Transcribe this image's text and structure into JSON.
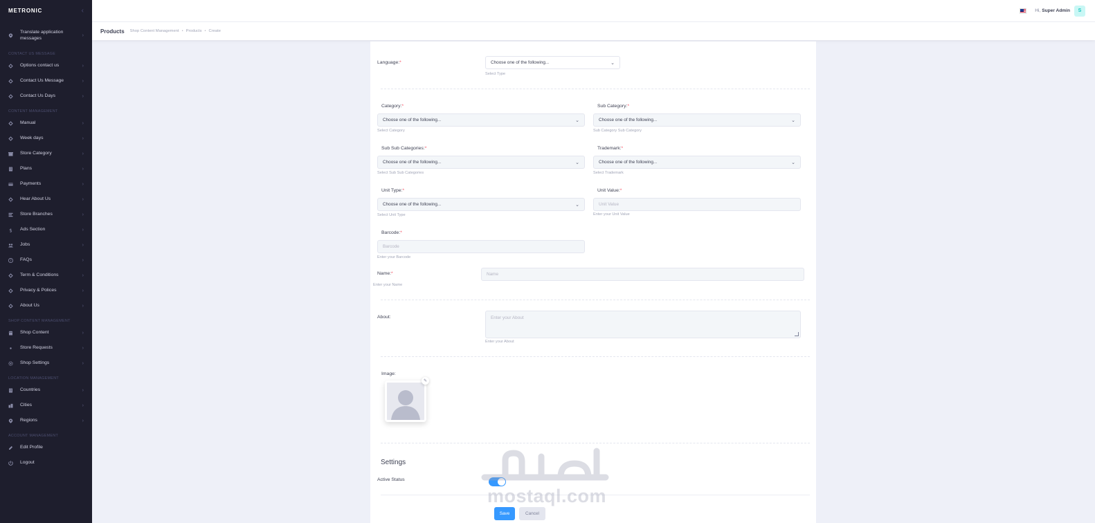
{
  "brand": {
    "name": "METRONIC"
  },
  "sidebar": {
    "top_item": {
      "label": "Translate application messages",
      "icon": "pin-icon"
    },
    "sections": [
      {
        "title": "CONTACT US MESSAGE",
        "items": [
          {
            "label": "Options contact us",
            "icon": "diamond-icon"
          },
          {
            "label": "Contact Us Message",
            "icon": "diamond-icon"
          },
          {
            "label": "Contact Us Days",
            "icon": "diamond-icon"
          }
        ]
      },
      {
        "title": "CONTENT MANAGEMENT",
        "items": [
          {
            "label": "Manual",
            "icon": "diamond-icon"
          },
          {
            "label": "Week days",
            "icon": "diamond-icon"
          },
          {
            "label": "Store Category",
            "icon": "store-icon"
          },
          {
            "label": "Plans",
            "icon": "building-icon"
          },
          {
            "label": "Payments",
            "icon": "card-icon"
          },
          {
            "label": "Hear About Us",
            "icon": "diamond-icon"
          },
          {
            "label": "Store Branches",
            "icon": "branches-icon"
          },
          {
            "label": "Ads Section",
            "icon": "dollar-icon"
          },
          {
            "label": "Jobs",
            "icon": "jobs-icon"
          },
          {
            "label": "FAQs",
            "icon": "question-icon"
          },
          {
            "label": "Term & Conditions",
            "icon": "diamond-icon"
          },
          {
            "label": "Privacy & Polices",
            "icon": "diamond-icon"
          },
          {
            "label": "About Us",
            "icon": "diamond-icon"
          }
        ]
      },
      {
        "title": "SHOP CONTENT MANAGEMENT",
        "items": [
          {
            "label": "Shop Content",
            "icon": "shop-icon"
          },
          {
            "label": "Store Requests",
            "icon": "dot-icon"
          },
          {
            "label": "Shop Settings",
            "icon": "settings-icon"
          }
        ]
      },
      {
        "title": "LOCATION MANAGEMENT",
        "items": [
          {
            "label": "Countries",
            "icon": "building-icon"
          },
          {
            "label": "Cities",
            "icon": "city-icon"
          },
          {
            "label": "Regions",
            "icon": "pin-icon"
          }
        ]
      },
      {
        "title": "ACCOUNT MANAGEMENT",
        "items": [
          {
            "label": "Edit Profile",
            "icon": "edit-icon",
            "arrow": false
          },
          {
            "label": "Logout",
            "icon": "logout-icon",
            "arrow": false
          }
        ]
      }
    ]
  },
  "header": {
    "greeting": "Hi,",
    "user_name": "Super Admin",
    "avatar_letter": "S"
  },
  "subheader": {
    "title": "Products",
    "breadcrumbs": [
      "Shop Content Management",
      "Products",
      "Create"
    ]
  },
  "form": {
    "language": {
      "label": "Language:",
      "value": "Choose one of the following...",
      "hint": "Select Type"
    },
    "category": {
      "label": "Category:",
      "value": "Choose one of the following...",
      "hint": "Select Category"
    },
    "sub_category": {
      "label": "Sub Category:",
      "value": "Choose one of the following...",
      "hint": "Sub Category Sub Category"
    },
    "sub_sub_categories": {
      "label": "Sub Sub Categories:",
      "value": "Choose one of the following...",
      "hint": "Select Sub Sub Categories"
    },
    "trademark": {
      "label": "Trademark:",
      "value": "Choose one of the following...",
      "hint": "Select Trademark"
    },
    "unit_type": {
      "label": "Unit Type:",
      "value": "Choose one of the following...",
      "hint": "Select Unit Type"
    },
    "unit_value": {
      "label": "Unit Value:",
      "placeholder": "Unit Value",
      "hint": "Enter your Unit Value"
    },
    "barcode": {
      "label": "Barcode:",
      "placeholder": "Barcode",
      "hint": "Enter your Barcode"
    },
    "name": {
      "label": "Name:",
      "placeholder": "Name",
      "hint": "Enter your Name"
    },
    "about": {
      "label": "About:",
      "placeholder": "Enter your  About",
      "hint": "Enter your About"
    },
    "image": {
      "label": "Image:"
    },
    "required_mark": "*"
  },
  "settings": {
    "title": "Settings",
    "active_status_label": "Active Status",
    "active_status_on": true
  },
  "actions": {
    "save": "Save",
    "cancel": "Cancel"
  },
  "watermark": {
    "text": "mostaql.com",
    "arabic": "مستقل"
  },
  "colors": {
    "sidebar_bg": "#1e1e2d",
    "primary": "#3699ff",
    "required": "#f64e60",
    "page_bg": "#eef0f8"
  }
}
